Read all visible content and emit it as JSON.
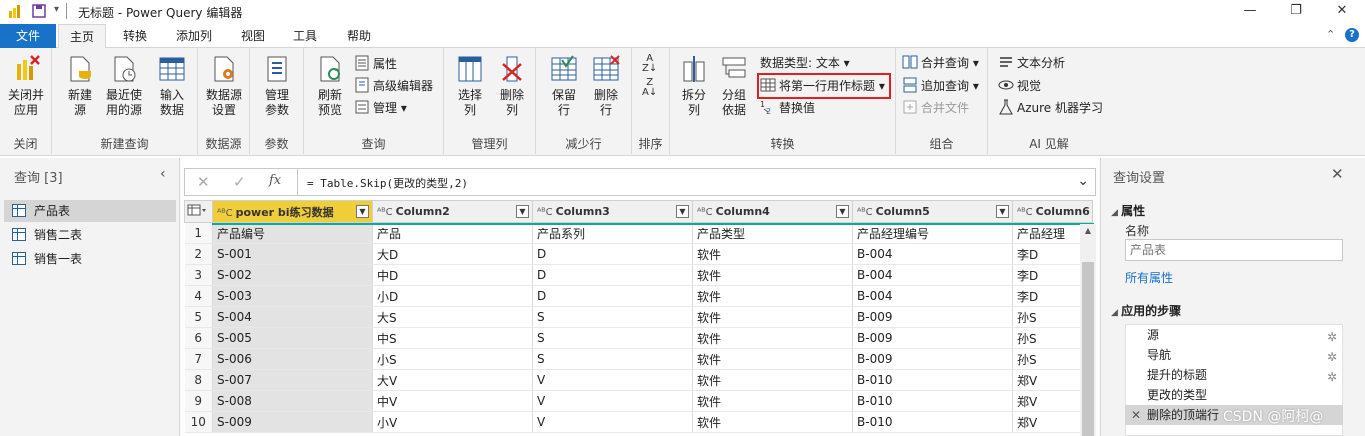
{
  "window": {
    "title": "无标题 - Power Query 编辑器",
    "minimize": "—",
    "restore": "❐",
    "close": "✕"
  },
  "tabs": [
    {
      "label": "文件"
    },
    {
      "label": "主页"
    },
    {
      "label": "转换"
    },
    {
      "label": "添加列"
    },
    {
      "label": "视图"
    },
    {
      "label": "工具"
    },
    {
      "label": "帮助"
    }
  ],
  "ribbon": {
    "close_apply": "关闭并\n应用",
    "close_group": "关闭",
    "new_source": "新建\n源",
    "recent_sources": "最近使\n用的源",
    "enter_data": "输入\n数据",
    "new_query_group": "新建查询",
    "datasource_settings": "数据源\n设置",
    "datasource_group": "数据源",
    "manage_params": "管理\n参数",
    "params_group": "参数",
    "refresh_preview": "刷新\n预览",
    "properties": "属性",
    "advanced_editor": "高级编辑器",
    "manage": "管理",
    "query_group": "查询",
    "choose_cols": "选择\n列",
    "remove_cols": "删除\n列",
    "manage_cols_group": "管理列",
    "keep_rows": "保留\n行",
    "remove_rows": "删除\n行",
    "reduce_rows_group": "减少行",
    "sort_group": "排序",
    "split_col": "拆分\n列",
    "group_by": "分组\n依据",
    "data_type": "数据类型: 文本",
    "first_row_header": "将第一行用作标题",
    "replace_values": "替换值",
    "transform_group": "转换",
    "merge_queries": "合并查询",
    "append_queries": "追加查询",
    "combine_files": "合并文件",
    "combine_group": "组合",
    "text_analytics": "文本分析",
    "vision": "视觉",
    "azure_ml": "Azure 机器学习",
    "ai_group": "AI 见解"
  },
  "queries": {
    "header": "查询 [3]",
    "items": [
      {
        "name": "产品表"
      },
      {
        "name": "销售二表"
      },
      {
        "name": "销售一表"
      }
    ]
  },
  "formula": {
    "text": "= Table.Skip(更改的类型,2)"
  },
  "table": {
    "columns": [
      "power bi练习数据",
      "Column2",
      "Column3",
      "Column4",
      "Column5",
      "Column6"
    ],
    "rows": [
      [
        "1",
        "产品编号",
        "产品",
        "产品系列",
        "产品类型",
        "产品经理编号",
        "产品经理"
      ],
      [
        "2",
        "S-001",
        "大D",
        "D",
        "软件",
        "B-004",
        "李D"
      ],
      [
        "3",
        "S-002",
        "中D",
        "D",
        "软件",
        "B-004",
        "李D"
      ],
      [
        "4",
        "S-003",
        "小D",
        "D",
        "软件",
        "B-004",
        "李D"
      ],
      [
        "5",
        "S-004",
        "大S",
        "S",
        "软件",
        "B-009",
        "孙S"
      ],
      [
        "6",
        "S-005",
        "中S",
        "S",
        "软件",
        "B-009",
        "孙S"
      ],
      [
        "7",
        "S-006",
        "小S",
        "S",
        "软件",
        "B-009",
        "孙S"
      ],
      [
        "8",
        "S-007",
        "大V",
        "V",
        "软件",
        "B-010",
        "郑V"
      ],
      [
        "9",
        "S-008",
        "中V",
        "V",
        "软件",
        "B-010",
        "郑V"
      ],
      [
        "10",
        "S-009",
        "小V",
        "V",
        "软件",
        "B-010",
        "郑V"
      ]
    ]
  },
  "settings": {
    "title": "查询设置",
    "properties_header": "属性",
    "name_label": "名称",
    "name_value": "产品表",
    "all_properties": "所有属性",
    "steps_header": "应用的步骤",
    "steps": [
      {
        "label": "源",
        "gear": true
      },
      {
        "label": "导航",
        "gear": true
      },
      {
        "label": "提升的标题",
        "gear": true
      },
      {
        "label": "更改的类型",
        "gear": false
      },
      {
        "label": "删除的顶端行",
        "gear": false
      }
    ]
  },
  "watermark": "CSDN @阿柯@",
  "colors": {
    "file_tab": "#1772c8",
    "accent_teal": "#11a89a",
    "highlight_header": "#f0ce3a",
    "red_box": "#e02020"
  }
}
